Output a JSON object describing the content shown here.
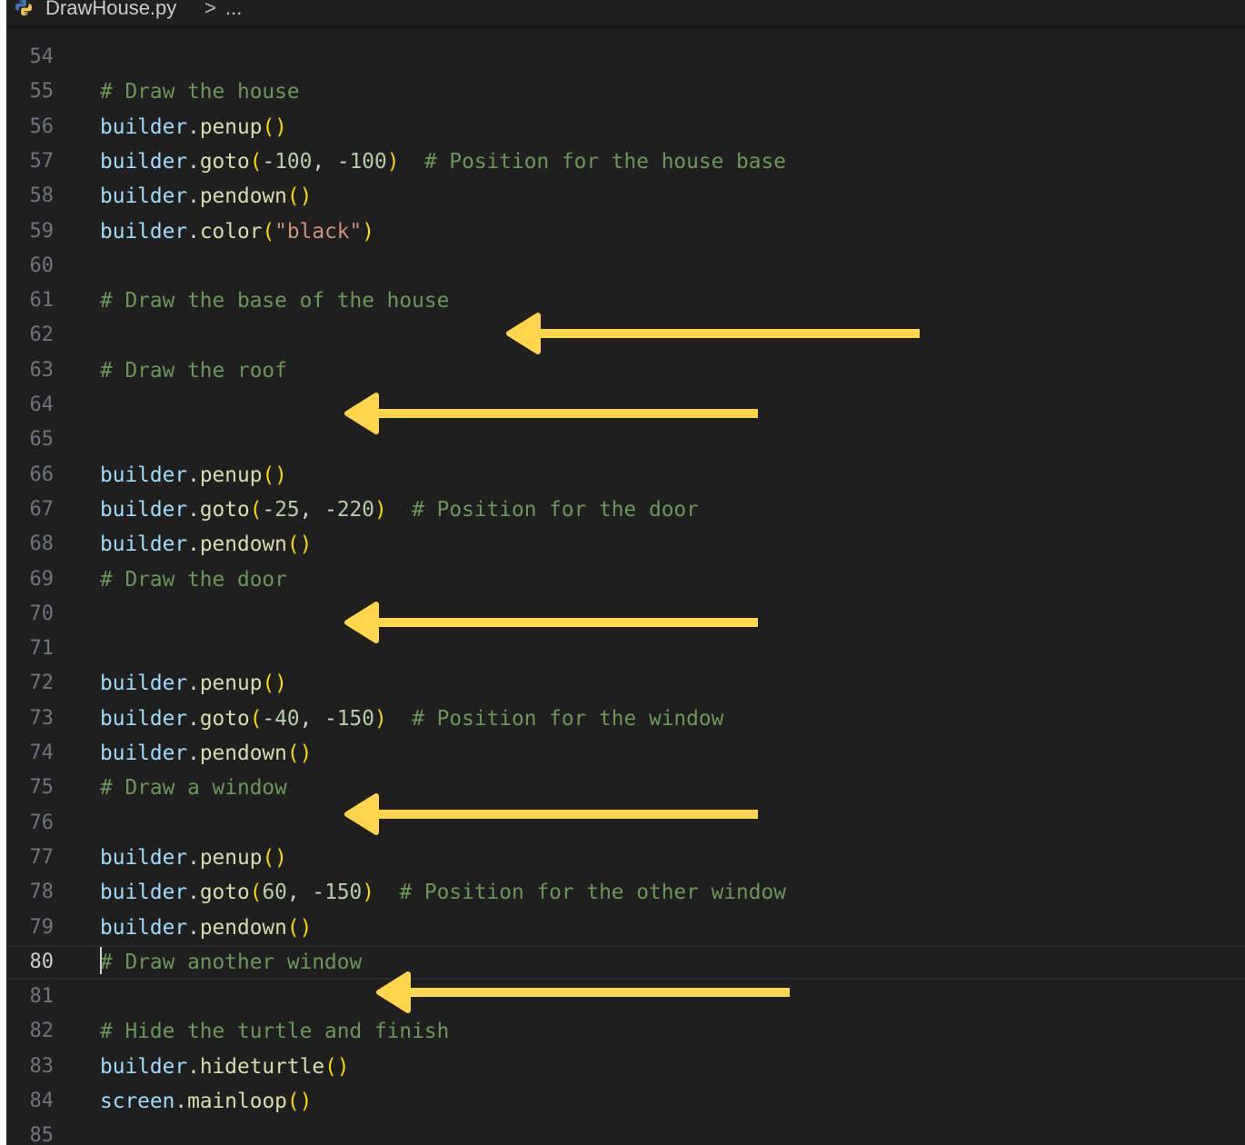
{
  "breadcrumb": {
    "file_name": "DrawHouse.py",
    "separator": ">",
    "more": "...",
    "file_icon": "python-icon"
  },
  "editor": {
    "current_line": "80",
    "lines": [
      {
        "num": "54",
        "tokens": []
      },
      {
        "num": "55",
        "tokens": [
          {
            "t": "cm",
            "v": "# Draw the house"
          }
        ]
      },
      {
        "num": "56",
        "tokens": [
          {
            "t": "var",
            "v": "builder"
          },
          {
            "t": "punct",
            "v": "."
          },
          {
            "t": "fn",
            "v": "penup"
          },
          {
            "t": "paren",
            "v": "()"
          }
        ]
      },
      {
        "num": "57",
        "tokens": [
          {
            "t": "var",
            "v": "builder"
          },
          {
            "t": "punct",
            "v": "."
          },
          {
            "t": "fn",
            "v": "goto"
          },
          {
            "t": "paren",
            "v": "("
          },
          {
            "t": "punct",
            "v": "-"
          },
          {
            "t": "num",
            "v": "100"
          },
          {
            "t": "punct",
            "v": ", -"
          },
          {
            "t": "num",
            "v": "100"
          },
          {
            "t": "paren",
            "v": ")"
          },
          {
            "t": "punct",
            "v": "  "
          },
          {
            "t": "cm",
            "v": "# Position for the house base"
          }
        ]
      },
      {
        "num": "58",
        "tokens": [
          {
            "t": "var",
            "v": "builder"
          },
          {
            "t": "punct",
            "v": "."
          },
          {
            "t": "fn",
            "v": "pendown"
          },
          {
            "t": "paren",
            "v": "()"
          }
        ]
      },
      {
        "num": "59",
        "tokens": [
          {
            "t": "var",
            "v": "builder"
          },
          {
            "t": "punct",
            "v": "."
          },
          {
            "t": "fn",
            "v": "color"
          },
          {
            "t": "paren",
            "v": "("
          },
          {
            "t": "str",
            "v": "\"black\""
          },
          {
            "t": "paren",
            "v": ")"
          }
        ]
      },
      {
        "num": "60",
        "tokens": []
      },
      {
        "num": "61",
        "tokens": [
          {
            "t": "cm",
            "v": "# Draw the base of the house"
          }
        ]
      },
      {
        "num": "62",
        "tokens": []
      },
      {
        "num": "63",
        "tokens": [
          {
            "t": "cm",
            "v": "# Draw the roof"
          }
        ]
      },
      {
        "num": "64",
        "tokens": []
      },
      {
        "num": "65",
        "tokens": []
      },
      {
        "num": "66",
        "tokens": [
          {
            "t": "var",
            "v": "builder"
          },
          {
            "t": "punct",
            "v": "."
          },
          {
            "t": "fn",
            "v": "penup"
          },
          {
            "t": "paren",
            "v": "()"
          }
        ]
      },
      {
        "num": "67",
        "tokens": [
          {
            "t": "var",
            "v": "builder"
          },
          {
            "t": "punct",
            "v": "."
          },
          {
            "t": "fn",
            "v": "goto"
          },
          {
            "t": "paren",
            "v": "("
          },
          {
            "t": "punct",
            "v": "-"
          },
          {
            "t": "num",
            "v": "25"
          },
          {
            "t": "punct",
            "v": ", -"
          },
          {
            "t": "num",
            "v": "220"
          },
          {
            "t": "paren",
            "v": ")"
          },
          {
            "t": "punct",
            "v": "  "
          },
          {
            "t": "cm",
            "v": "# Position for the door"
          }
        ]
      },
      {
        "num": "68",
        "tokens": [
          {
            "t": "var",
            "v": "builder"
          },
          {
            "t": "punct",
            "v": "."
          },
          {
            "t": "fn",
            "v": "pendown"
          },
          {
            "t": "paren",
            "v": "()"
          }
        ]
      },
      {
        "num": "69",
        "tokens": [
          {
            "t": "cm",
            "v": "# Draw the door"
          }
        ]
      },
      {
        "num": "70",
        "tokens": []
      },
      {
        "num": "71",
        "tokens": []
      },
      {
        "num": "72",
        "tokens": [
          {
            "t": "var",
            "v": "builder"
          },
          {
            "t": "punct",
            "v": "."
          },
          {
            "t": "fn",
            "v": "penup"
          },
          {
            "t": "paren",
            "v": "()"
          }
        ]
      },
      {
        "num": "73",
        "tokens": [
          {
            "t": "var",
            "v": "builder"
          },
          {
            "t": "punct",
            "v": "."
          },
          {
            "t": "fn",
            "v": "goto"
          },
          {
            "t": "paren",
            "v": "("
          },
          {
            "t": "punct",
            "v": "-"
          },
          {
            "t": "num",
            "v": "40"
          },
          {
            "t": "punct",
            "v": ", -"
          },
          {
            "t": "num",
            "v": "150"
          },
          {
            "t": "paren",
            "v": ")"
          },
          {
            "t": "punct",
            "v": "  "
          },
          {
            "t": "cm",
            "v": "# Position for the window"
          }
        ]
      },
      {
        "num": "74",
        "tokens": [
          {
            "t": "var",
            "v": "builder"
          },
          {
            "t": "punct",
            "v": "."
          },
          {
            "t": "fn",
            "v": "pendown"
          },
          {
            "t": "paren",
            "v": "()"
          }
        ]
      },
      {
        "num": "75",
        "tokens": [
          {
            "t": "cm",
            "v": "# Draw a window"
          }
        ]
      },
      {
        "num": "76",
        "tokens": []
      },
      {
        "num": "77",
        "tokens": [
          {
            "t": "var",
            "v": "builder"
          },
          {
            "t": "punct",
            "v": "."
          },
          {
            "t": "fn",
            "v": "penup"
          },
          {
            "t": "paren",
            "v": "()"
          }
        ]
      },
      {
        "num": "78",
        "tokens": [
          {
            "t": "var",
            "v": "builder"
          },
          {
            "t": "punct",
            "v": "."
          },
          {
            "t": "fn",
            "v": "goto"
          },
          {
            "t": "paren",
            "v": "("
          },
          {
            "t": "num",
            "v": "60"
          },
          {
            "t": "punct",
            "v": ", -"
          },
          {
            "t": "num",
            "v": "150"
          },
          {
            "t": "paren",
            "v": ")"
          },
          {
            "t": "punct",
            "v": "  "
          },
          {
            "t": "cm",
            "v": "# Position for the other window"
          }
        ]
      },
      {
        "num": "79",
        "tokens": [
          {
            "t": "var",
            "v": "builder"
          },
          {
            "t": "punct",
            "v": "."
          },
          {
            "t": "fn",
            "v": "pendown"
          },
          {
            "t": "paren",
            "v": "()"
          }
        ]
      },
      {
        "num": "80",
        "tokens": [
          {
            "t": "cursor",
            "v": ""
          },
          {
            "t": "cm",
            "v": "# Draw another window"
          }
        ]
      },
      {
        "num": "81",
        "tokens": []
      },
      {
        "num": "82",
        "tokens": [
          {
            "t": "cm",
            "v": "# Hide the turtle and finish"
          }
        ]
      },
      {
        "num": "83",
        "tokens": [
          {
            "t": "var",
            "v": "builder"
          },
          {
            "t": "punct",
            "v": "."
          },
          {
            "t": "fn",
            "v": "hideturtle"
          },
          {
            "t": "paren",
            "v": "()"
          }
        ]
      },
      {
        "num": "84",
        "tokens": [
          {
            "t": "var",
            "v": "screen"
          },
          {
            "t": "punct",
            "v": "."
          },
          {
            "t": "fn",
            "v": "mainloop"
          },
          {
            "t": "paren",
            "v": "()"
          }
        ]
      },
      {
        "num": "85",
        "tokens": []
      }
    ]
  },
  "annotations": {
    "arrow_color": "#ffd54a",
    "arrows": [
      {
        "points_to_line": "62"
      },
      {
        "points_to_line": "64"
      },
      {
        "points_to_line": "70"
      },
      {
        "points_to_line": "76"
      },
      {
        "points_to_line": "81"
      }
    ]
  },
  "theme": {
    "background": "#1f1f1f",
    "variable": "#9cdcfe",
    "function": "#dcdcaa",
    "number": "#b5cea8",
    "string": "#ce9178",
    "comment": "#6a9955",
    "bracket": "#ffd700"
  }
}
